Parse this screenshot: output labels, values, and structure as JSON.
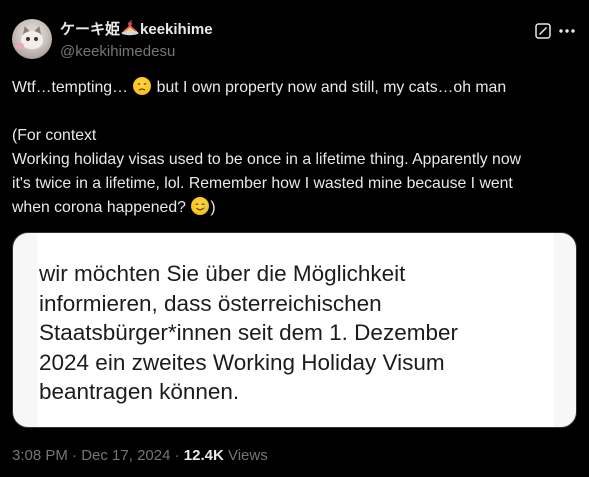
{
  "post": {
    "author": {
      "name_prefix": "ケーキ姫",
      "name_suffix": "keekihime",
      "cake_emoji_icon": "cake-icon",
      "handle": "@keekihimedesu"
    },
    "actions": {
      "grok_icon": "grok-icon",
      "more_icon": "more-horizontal-icon"
    },
    "body": {
      "line1_before": "Wtf…tempting… ",
      "line1_emoji": "disappointed-face-icon",
      "line1_after": " but I own property now and still, my cats…oh man",
      "line2": "(For context",
      "line3": "Working holiday visas used to be once in a lifetime thing. Apparently now",
      "line4": "it's twice in a lifetime, lol. Remember how I wasted mine because I went",
      "line5_before": "when corona happened? ",
      "line5_emoji": "crying-smile-face-icon",
      "line5_after": ")"
    },
    "media_text": [
      "wir möchten Sie über die Möglichkeit",
      "informieren, dass österreichischen",
      "Staatsbürger*innen seit dem 1. Dezember",
      "2024 ein zweites Working Holiday Visum",
      "beantragen können."
    ],
    "meta": {
      "time": "3:08 PM",
      "separator": " · ",
      "date": "Dec 17, 2024",
      "views_count": "12.4K",
      "views_label": " Views"
    }
  },
  "colors": {
    "background": "#000000",
    "text_primary": "#e7e9ea",
    "text_secondary": "#71767b",
    "border": "#2f3336"
  }
}
